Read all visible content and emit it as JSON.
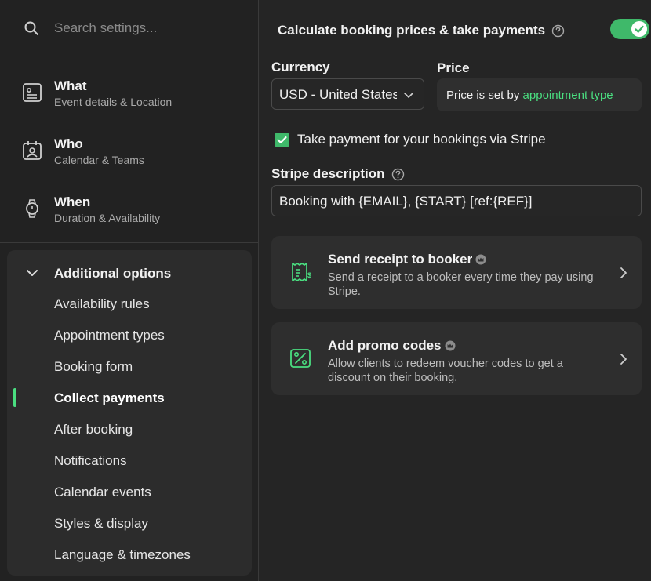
{
  "search": {
    "placeholder": "Search settings..."
  },
  "nav": [
    {
      "title": "What",
      "sub": "Event details & Location"
    },
    {
      "title": "Who",
      "sub": "Calendar & Teams"
    },
    {
      "title": "When",
      "sub": "Duration & Availability"
    }
  ],
  "additional": {
    "header": "Additional options",
    "items": [
      "Availability rules",
      "Appointment types",
      "Booking form",
      "Collect payments",
      "After booking",
      "Notifications",
      "Calendar events",
      "Styles & display",
      "Language & timezones"
    ],
    "active_index": 3
  },
  "main": {
    "toggle_label": "Calculate booking prices & take payments",
    "toggle_on": true,
    "currency_label": "Currency",
    "currency_value": "USD - United States",
    "price_label": "Price",
    "price_prefix": "Price is set by",
    "price_link": "appointment type",
    "stripe_checkbox_label": "Take payment for your bookings via Stripe",
    "stripe_checked": true,
    "stripe_desc_label": "Stripe description",
    "stripe_desc_value": "Booking with {EMAIL}, {START} [ref:{REF}]",
    "cards": [
      {
        "title": "Send receipt to booker",
        "desc": "Send a receipt to a booker every time they pay using Stripe.",
        "icon": "receipt-icon"
      },
      {
        "title": "Add promo codes",
        "desc": "Allow clients to redeem voucher codes to get a discount on their booking.",
        "icon": "percent-icon"
      }
    ]
  },
  "colors": {
    "accent": "#4ade80",
    "toggle": "#3fb96a",
    "bg": "#252525",
    "sidebar": "#222222"
  }
}
